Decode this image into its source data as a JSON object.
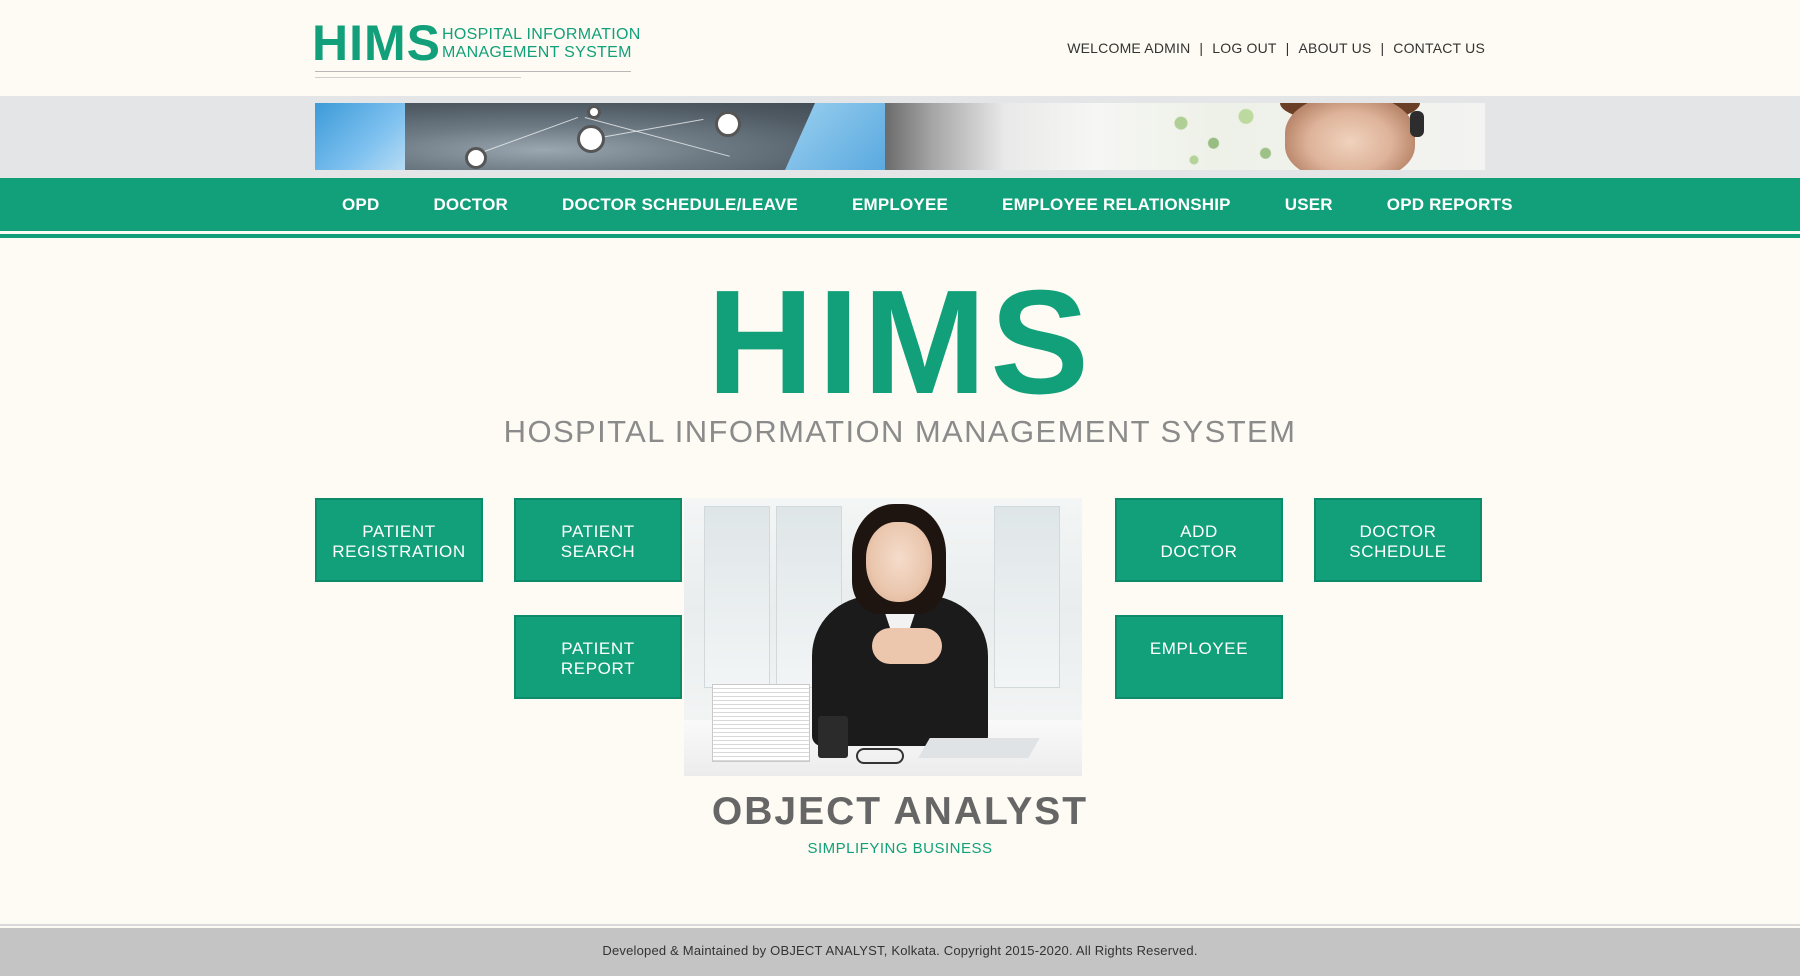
{
  "header": {
    "logo": {
      "big": "HIMS",
      "line1": "HOSPITAL INFORMATION",
      "line2": "MANAGEMENT SYSTEM"
    },
    "links": {
      "welcome": "WELCOME ADMIN",
      "logout": "LOG OUT",
      "about": "ABOUT US",
      "contact": "CONTACT US",
      "separator": "|"
    }
  },
  "nav": {
    "items": [
      {
        "label": "OPD"
      },
      {
        "label": "DOCTOR"
      },
      {
        "label": "DOCTOR SCHEDULE/LEAVE"
      },
      {
        "label": "EMPLOYEE"
      },
      {
        "label": "EMPLOYEE RELATIONSHIP"
      },
      {
        "label": "USER"
      },
      {
        "label": "OPD REPORTS"
      }
    ]
  },
  "hero": {
    "title": "HIMS",
    "subtitle": "HOSPITAL INFORMATION MANAGEMENT SYSTEM"
  },
  "tiles": {
    "patient_registration": {
      "line1": "PATIENT",
      "line2": "REGISTRATION"
    },
    "patient_search": {
      "line1": "PATIENT",
      "line2": "SEARCH"
    },
    "patient_report": {
      "line1": "PATIENT",
      "line2": "REPORT"
    },
    "add_doctor": {
      "line1": "ADD",
      "line2": "DOCTOR"
    },
    "doctor_schedule": {
      "line1": "DOCTOR",
      "line2": "SCHEDULE"
    },
    "employee": {
      "line1": "EMPLOYEE"
    }
  },
  "brand": {
    "name": "OBJECT ANALYST",
    "tagline": "SIMPLIFYING BUSINESS"
  },
  "footer": {
    "text": "Developed & Maintained by OBJECT ANALYST, Kolkata. Copyright 2015-2020. All Rights Reserved."
  },
  "colors": {
    "accent": "#12a07a",
    "background": "#fdfbf3",
    "footer": "#c4c4c4",
    "muted_text": "#8b8b8b"
  },
  "icons": {
    "logo": "hims-logo",
    "banner": "banner-image",
    "photo": "office-woman-photo"
  }
}
